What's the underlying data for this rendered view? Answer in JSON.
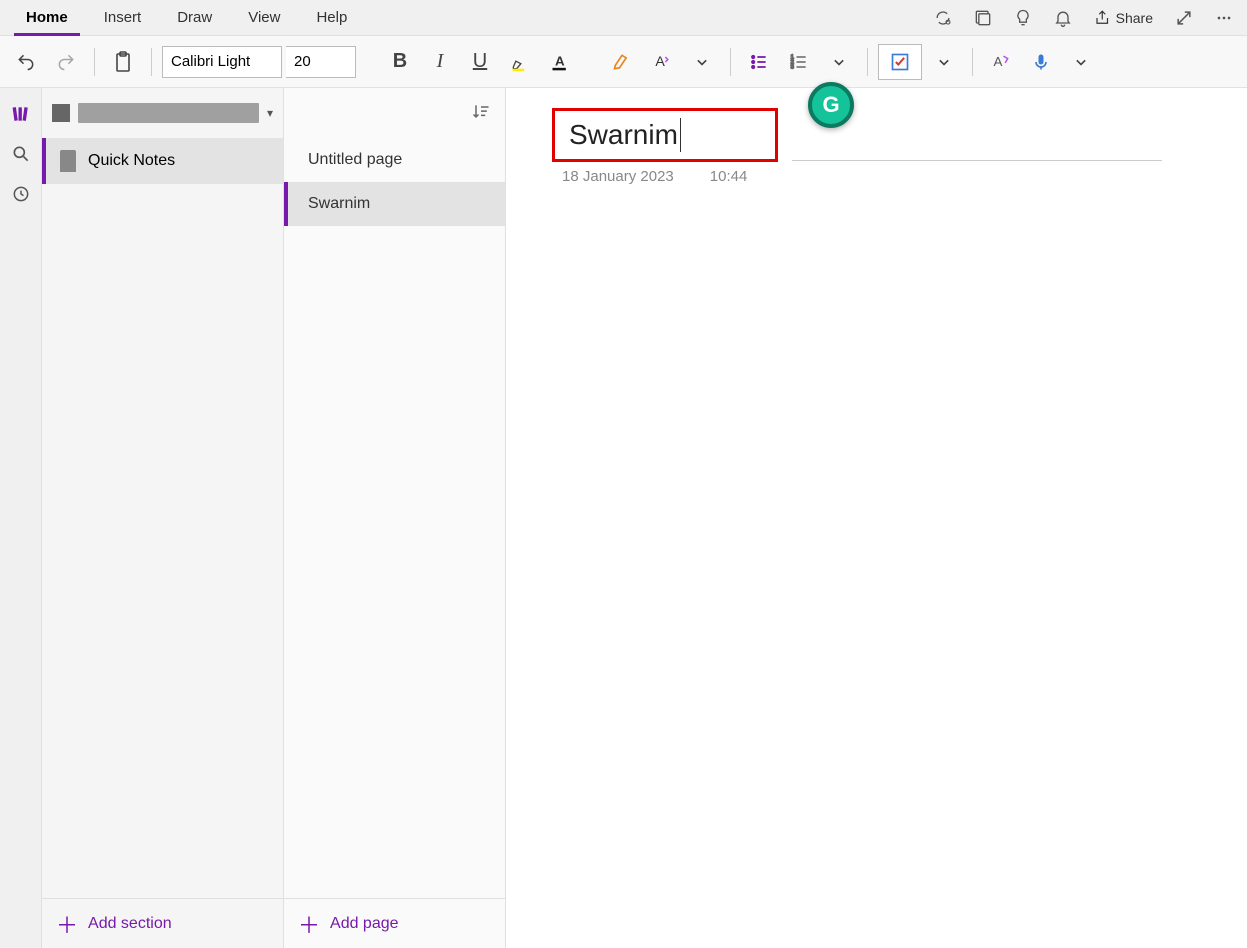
{
  "menu": {
    "items": [
      "Home",
      "Insert",
      "Draw",
      "View",
      "Help"
    ],
    "active": 0,
    "share": "Share"
  },
  "toolbar": {
    "font_name": "Calibri Light",
    "font_size": "20"
  },
  "sidebar": {
    "sections": [
      {
        "label": "Quick Notes"
      }
    ],
    "add_section": "Add section"
  },
  "pages": {
    "items": [
      {
        "label": "Untitled page",
        "active": false
      },
      {
        "label": "Swarnim",
        "active": true
      }
    ],
    "add_page": "Add page"
  },
  "note": {
    "title": "Swarnim",
    "date": "18 January 2023",
    "time": "10:44"
  }
}
